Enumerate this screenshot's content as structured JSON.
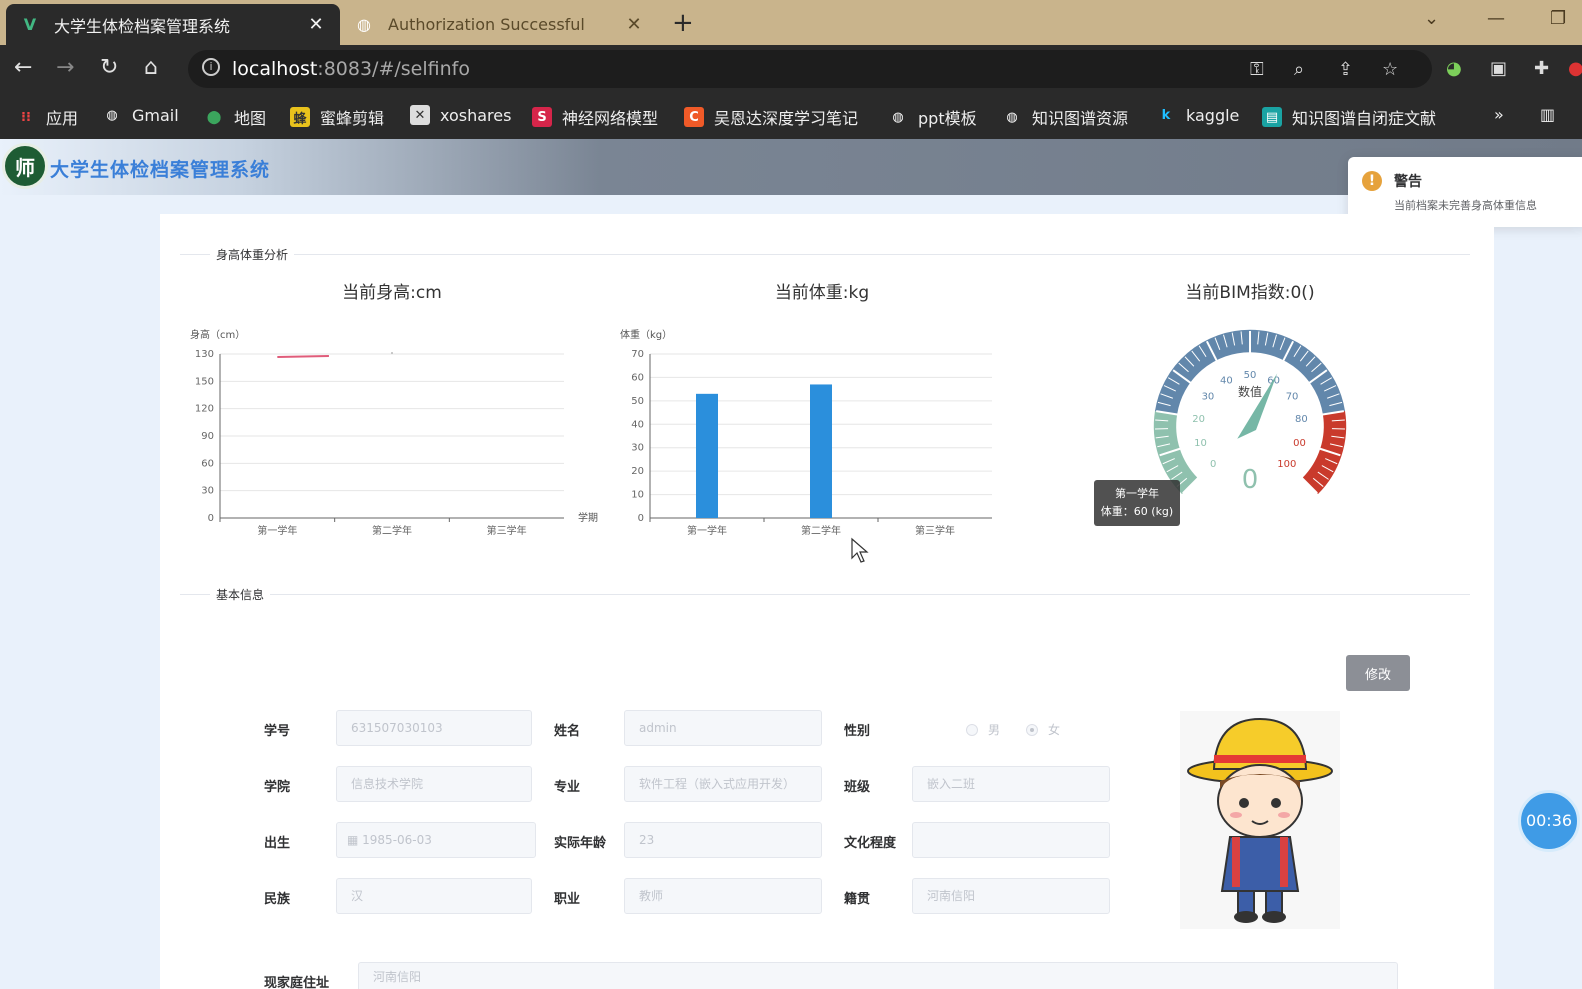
{
  "browser": {
    "tabs": [
      {
        "title": "大学生体检档案管理系统",
        "active": true
      },
      {
        "title": "Authorization Successful",
        "active": false
      }
    ],
    "url_host": "localhost",
    "url_rest": ":8083/#/selfinfo",
    "bookmarks": [
      "应用",
      "Gmail",
      "地图",
      "蜜蜂剪辑",
      "xoshares",
      "神经网络模型",
      "吴恩达深度学习笔记",
      "ppt模板",
      "知识图谱资源",
      "kaggle",
      "知识图谱自闭症文献"
    ],
    "more": "»"
  },
  "app": {
    "logo_glyph": "师",
    "title": "大学生体检档案管理系统"
  },
  "notification": {
    "title": "警告",
    "message": "当前档案未完善身高体重信息",
    "accent": "#e6a23c"
  },
  "sections": {
    "analysis": "身高体重分析",
    "basic": "基本信息"
  },
  "charts": {
    "height_title": "当前身高:cm",
    "weight_title": "当前体重:kg",
    "bmi_title": "当前BIM指数:0()"
  },
  "chart_data": [
    {
      "type": "line",
      "ylabel": "身高（cm）",
      "xlabel": "学期",
      "categories": [
        "第一学年",
        "第二学年",
        "第三学年"
      ],
      "y_ticks": [
        "0",
        "30",
        "60",
        "90",
        "120",
        "150",
        "130"
      ],
      "series": [
        {
          "values": [
            130,
            130,
            null
          ]
        }
      ],
      "color": "#e05c7a"
    },
    {
      "type": "bar",
      "ylabel": "体重（kg）",
      "categories": [
        "第一学年",
        "第二学年",
        "第三学年"
      ],
      "ylim": [
        0,
        70
      ],
      "y_ticks": [
        "0",
        "10",
        "20",
        "30",
        "40",
        "50",
        "60",
        "70"
      ],
      "values": [
        53,
        57,
        null
      ],
      "color": "#2b8fdc"
    },
    {
      "type": "gauge",
      "name": "数值",
      "min": 0,
      "max": 100,
      "value": 0,
      "value_label": "0",
      "tick_labels": [
        "0",
        "10",
        "20",
        "30",
        "40",
        "50",
        "60",
        "70",
        "80",
        "00",
        "100"
      ],
      "bands": [
        {
          "to": 0.2,
          "color": "#8fc1ae"
        },
        {
          "to": 0.8,
          "color": "#6287ab"
        },
        {
          "to": 1.0,
          "color": "#c93a2c"
        }
      ],
      "tooltip": {
        "line1": "第一学年",
        "line2": "体重：60 (kg)"
      }
    }
  ],
  "form": {
    "edit_label": "修改",
    "fields": {
      "student_id": {
        "label": "学号",
        "value": "631507030103"
      },
      "name": {
        "label": "姓名",
        "value": "admin"
      },
      "gender": {
        "label": "性别",
        "options": [
          "男",
          "女"
        ],
        "selected": "女"
      },
      "college": {
        "label": "学院",
        "value": "信息技术学院"
      },
      "major": {
        "label": "专业",
        "value": "软件工程（嵌入式应用开发）"
      },
      "class": {
        "label": "班级",
        "value": "嵌入二班"
      },
      "birth": {
        "label": "出生",
        "value": "1985-06-03"
      },
      "age": {
        "label": "实际年龄",
        "value": "23"
      },
      "education": {
        "label": "文化程度",
        "value": ""
      },
      "ethnicity": {
        "label": "民族",
        "value": "汉"
      },
      "job": {
        "label": "职业",
        "value": "教师"
      },
      "origin": {
        "label": "籍贯",
        "value": "河南信阳"
      },
      "address": {
        "label": "现家庭住址",
        "value": "河南信阳"
      }
    }
  },
  "timer": "00:36"
}
